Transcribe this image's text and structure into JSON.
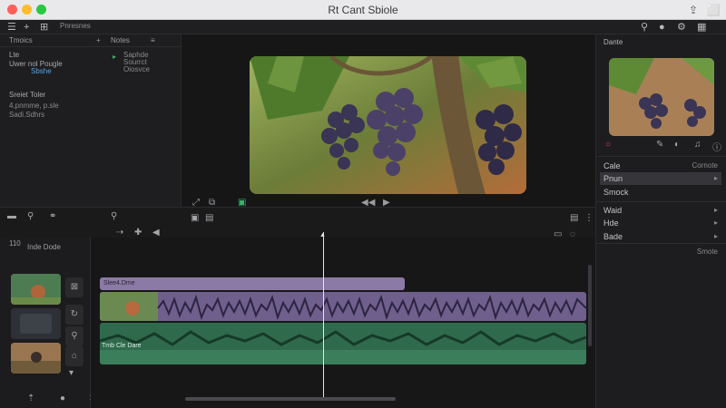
{
  "window": {
    "title": "Rt Cant Sbiole"
  },
  "toolbar": {
    "label": "Pnresnes"
  },
  "browser": {
    "tab_left": "Tmoics",
    "tab_right": "Notes",
    "items": [
      {
        "label": "Lte"
      },
      {
        "label": "Uwer nol Pougle"
      },
      {
        "label": "Sbshe"
      },
      {
        "label": "Sreiet  Toler"
      },
      {
        "label": "4,pnmme, p.sle"
      },
      {
        "label": "Sadi.Sdhrs"
      }
    ],
    "notes": [
      {
        "label": "Saphde"
      },
      {
        "label": "Sourrct"
      },
      {
        "label": "Oiosvce"
      }
    ]
  },
  "inspector": {
    "title": "Dante",
    "rows": [
      {
        "label": "Cale",
        "right": "Cornote"
      },
      {
        "label": "Pnun",
        "right": "▸"
      },
      {
        "label": "Smock",
        "right": ""
      },
      {
        "label": "Waid",
        "right": "▸"
      },
      {
        "label": "Hde",
        "right": "▸"
      },
      {
        "label": "Bade",
        "right": "▸"
      },
      {
        "label": "",
        "right": "Smote"
      }
    ]
  },
  "timeline": {
    "side_label1": "110",
    "side_label2": "Inde Dode",
    "clip_title": "Slee4.Dme",
    "audio_label": "Tmb Cle  Dare"
  },
  "colors": {
    "video_track": "#6f5f8d",
    "audio_track": "#2f6a4d",
    "link": "#5aa3e0"
  }
}
